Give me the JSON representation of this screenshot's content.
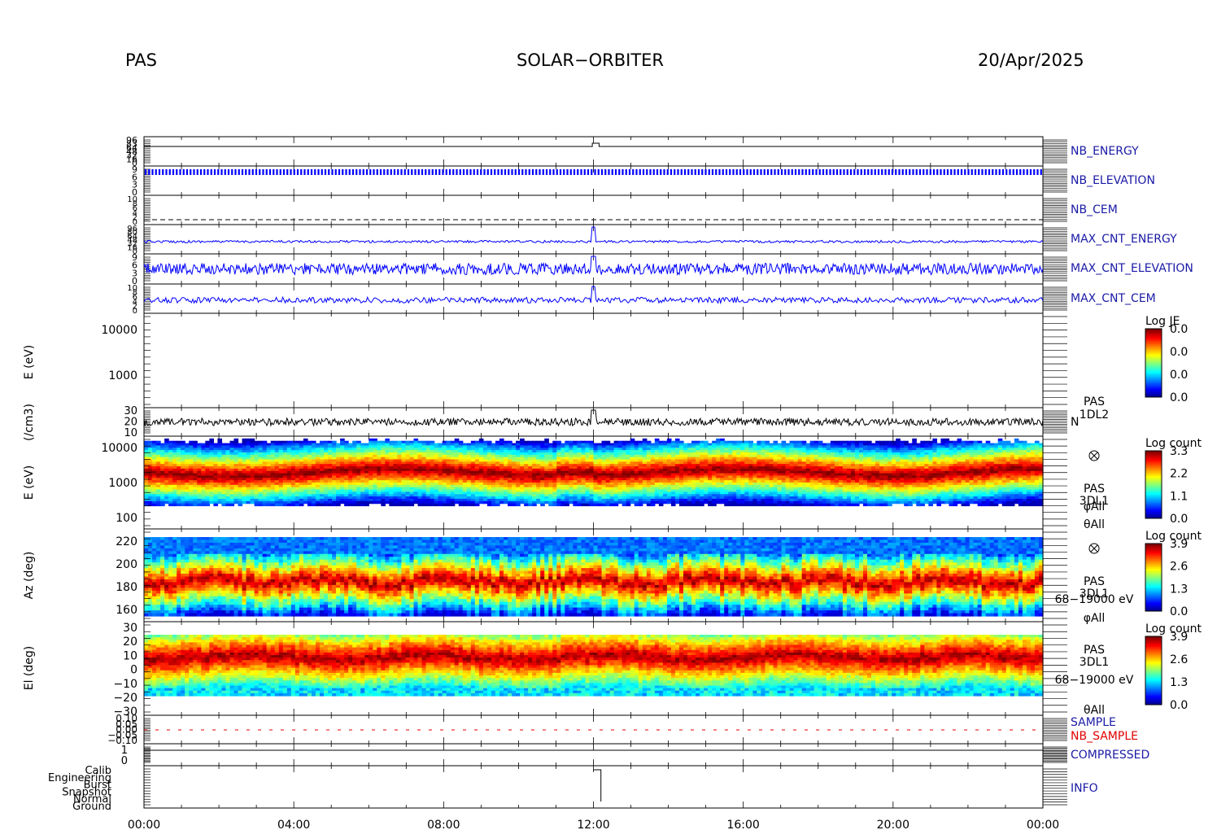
{
  "header": {
    "instrument": "PAS",
    "mission": "SOLAR−ORBITER",
    "date": "20/Apr/2025"
  },
  "colors": {
    "label_blue": "#1a1aa6",
    "trace_blue": "#0000ff",
    "label_red": "#e00000",
    "frame": "#000000"
  },
  "chart_data": {
    "type": "heatmap",
    "x_ticks": [
      "00:00",
      "04:00",
      "08:00",
      "12:00",
      "16:00",
      "20:00",
      "00:00"
    ],
    "x_range_hours": [
      0,
      24
    ],
    "panels": [
      {
        "id": "nb_energy",
        "label": "NB_ENERGY",
        "type": "line",
        "ticks": [
          "96",
          "83",
          "64",
          "48",
          "32",
          "16",
          "0"
        ],
        "level": 96,
        "event_level": 100
      },
      {
        "id": "nb_elevation",
        "label": "NB_ELEVATION",
        "type": "line",
        "ticks": [
          "9",
          "6",
          "3",
          "0"
        ],
        "level": 8
      },
      {
        "id": "nb_cem",
        "label": "NB_CEM",
        "type": "line",
        "ticks": [
          "10",
          "8",
          "6",
          "4",
          "2",
          "0"
        ],
        "level": 1
      },
      {
        "id": "max_cnt_energy",
        "label": "MAX_CNT_ENERGY",
        "type": "line",
        "ticks": [
          "96",
          "80",
          "64",
          "48",
          "32",
          "16",
          "0"
        ],
        "level": 40
      },
      {
        "id": "max_cnt_elevation",
        "label": "MAX_CNT_ELEVATION",
        "type": "line",
        "ticks": [
          "9",
          "6",
          "3",
          "0"
        ],
        "level": 5
      },
      {
        "id": "max_cnt_cem",
        "label": "MAX_CNT_CEM",
        "type": "line",
        "ticks": [
          "10",
          "8",
          "6",
          "4",
          "2",
          "0"
        ],
        "level": 5
      },
      {
        "id": "energy_l2",
        "ylabel": "E (eV)",
        "type": "heatmap",
        "yticks": [
          "10000",
          "1000"
        ],
        "colorbar": {
          "title": "Log JE",
          "ticks": [
            "0.0",
            "0.0",
            "0.0",
            "0.0"
          ]
        }
      },
      {
        "id": "density",
        "ylabel": "(/cm3)",
        "type": "line",
        "yticks": [
          "30",
          "20",
          "10"
        ],
        "side_labels": [
          "PAS",
          "1DL2",
          "N"
        ],
        "level": 18
      },
      {
        "id": "energy_l1",
        "ylabel": "E (eV)",
        "type": "heatmap",
        "yticks": [
          "10000",
          "1000",
          "100"
        ],
        "side_labels": [
          "PAS",
          "3DL1",
          "φAll",
          "θAll"
        ],
        "colorbar": {
          "title": "Log count",
          "ticks": [
            "3.3",
            "2.2",
            "1.1",
            "0.0"
          ]
        },
        "peak_energy_ev": 1300
      },
      {
        "id": "azimuth",
        "ylabel": "Az (deg)",
        "type": "heatmap",
        "yticks": [
          "220",
          "200",
          "180",
          "160"
        ],
        "side_labels": [
          "PAS",
          "3DL1",
          "68−19000 eV",
          "φAll"
        ],
        "colorbar": {
          "title": "Log count",
          "ticks": [
            "3.9",
            "2.6",
            "1.3",
            "0.0"
          ]
        },
        "peak_deg": 182
      },
      {
        "id": "elevation",
        "ylabel": "El (deg)",
        "type": "heatmap",
        "yticks": [
          "30",
          "20",
          "10",
          "0",
          "−10",
          "−20",
          "−30"
        ],
        "side_labels": [
          "PAS",
          "3DL1",
          "68−19000 eV",
          "θAll"
        ],
        "colorbar": {
          "title": "Log count",
          "ticks": [
            "3.9",
            "2.6",
            "1.3",
            "0.0"
          ]
        },
        "peak_deg": 8
      },
      {
        "id": "sample",
        "labels": [
          "SAMPLE",
          "NB_SAMPLE"
        ],
        "type": "line",
        "ticks": [
          "0.10",
          "0.05",
          "0.00",
          "−0.05",
          "−0.10"
        ]
      },
      {
        "id": "compressed",
        "label": "COMPRESSED",
        "type": "line",
        "ticks": [
          "1",
          "0"
        ]
      },
      {
        "id": "info",
        "label": "INFO",
        "type": "step",
        "ticks": [
          "Calib",
          "Engineering",
          "Burst",
          "Snapshot",
          "Normal",
          "Ground"
        ],
        "step_start_hour": 12.0,
        "step_end_hour": 12.2
      }
    ]
  }
}
